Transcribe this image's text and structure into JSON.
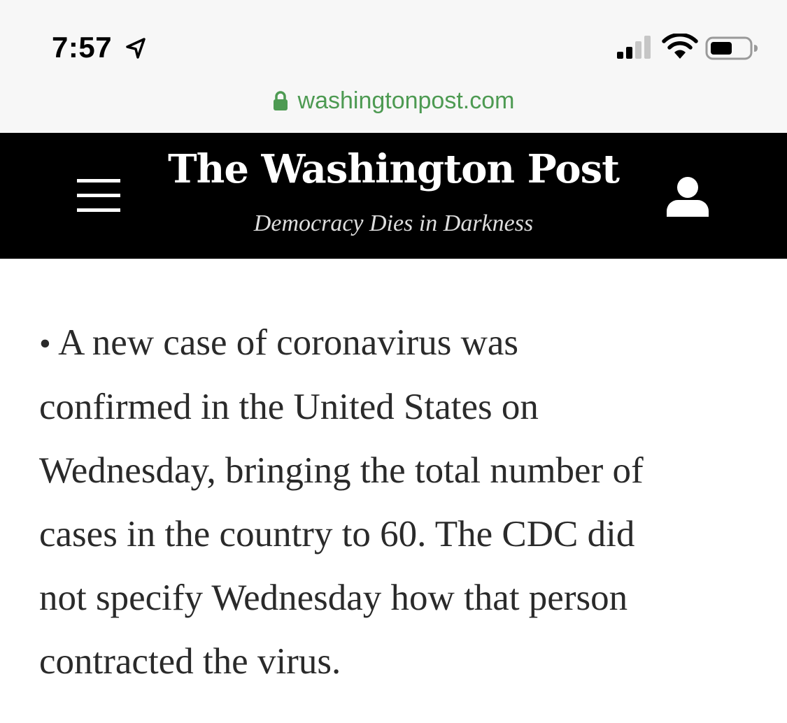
{
  "status_bar": {
    "time": "7:57",
    "icons": [
      "location-arrow-icon",
      "cellular-signal-icon",
      "wifi-icon",
      "battery-icon"
    ]
  },
  "browser": {
    "url": "washingtonpost.com",
    "url_color": "#4d9a52",
    "secure_icon": "lock-icon"
  },
  "masthead": {
    "logo_text": "The Washington Post",
    "tagline": "Democracy Dies in Darkness",
    "background": "#000000",
    "menu_icon": "hamburger-menu-icon",
    "account_icon": "user-account-icon"
  },
  "article": {
    "bullet": "•",
    "lines": [
      "A new case of coronavirus was",
      "confirmed in the United States on",
      "Wednesday, bringing the total number of",
      "cases in the country to 60. The CDC did",
      "not specify Wednesday how that person",
      "contracted the virus."
    ]
  }
}
